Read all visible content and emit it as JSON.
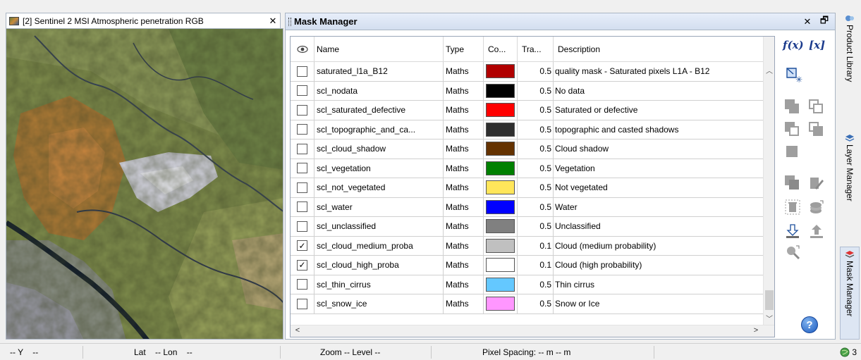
{
  "image_view": {
    "tab_title": "[2] Sentinel 2 MSI Atmospheric penetration RGB",
    "close_glyph": "✕"
  },
  "mask_manager": {
    "title": "Mask Manager",
    "close_glyph": "✕",
    "restore_glyph": "🗗",
    "columns": [
      "Name",
      "Type",
      "Co...",
      "Tra...",
      "Description"
    ],
    "rows": [
      {
        "checked": false,
        "name": "saturated_l1a_B12",
        "type": "Maths",
        "color": "#b10000",
        "transparency": "0.5",
        "description": "quality mask - Saturated pixels L1A - B12"
      },
      {
        "checked": false,
        "name": "scl_nodata",
        "type": "Maths",
        "color": "#000000",
        "transparency": "0.5",
        "description": "No data"
      },
      {
        "checked": false,
        "name": "scl_saturated_defective",
        "type": "Maths",
        "color": "#ff0000",
        "transparency": "0.5",
        "description": "Saturated or defective"
      },
      {
        "checked": false,
        "name": "scl_topographic_and_ca...",
        "type": "Maths",
        "color": "#2e2e2e",
        "transparency": "0.5",
        "description": "topographic and casted shadows"
      },
      {
        "checked": false,
        "name": "scl_cloud_shadow",
        "type": "Maths",
        "color": "#643200",
        "transparency": "0.5",
        "description": "Cloud shadow"
      },
      {
        "checked": false,
        "name": "scl_vegetation",
        "type": "Maths",
        "color": "#008000",
        "transparency": "0.5",
        "description": "Vegetation"
      },
      {
        "checked": false,
        "name": "scl_not_vegetated",
        "type": "Maths",
        "color": "#ffe65a",
        "transparency": "0.5",
        "description": "Not vegetated"
      },
      {
        "checked": false,
        "name": "scl_water",
        "type": "Maths",
        "color": "#0000ff",
        "transparency": "0.5",
        "description": "Water"
      },
      {
        "checked": false,
        "name": "scl_unclassified",
        "type": "Maths",
        "color": "#808080",
        "transparency": "0.5",
        "description": "Unclassified"
      },
      {
        "checked": true,
        "name": "scl_cloud_medium_proba",
        "type": "Maths",
        "color": "#c0c0c0",
        "transparency": "0.1",
        "description": "Cloud (medium probability)"
      },
      {
        "checked": true,
        "name": "scl_cloud_high_proba",
        "type": "Maths",
        "color": "#ffffff",
        "transparency": "0.1",
        "description": "Cloud (high probability)"
      },
      {
        "checked": false,
        "name": "scl_thin_cirrus",
        "type": "Maths",
        "color": "#64c8ff",
        "transparency": "0.5",
        "description": "Thin cirrus"
      },
      {
        "checked": false,
        "name": "scl_snow_ice",
        "type": "Maths",
        "color": "#ff96ff",
        "transparency": "0.5",
        "description": "Snow or Ice"
      }
    ],
    "tools": {
      "fx_label": "f(x)",
      "var_label": "[x]",
      "help_label": "?"
    }
  },
  "side_tabs": [
    "Product Library",
    "Layer Manager",
    "Mask Manager"
  ],
  "status_bar": {
    "y": "-- Y    --",
    "latlon": "Lat    -- Lon    --",
    "zoom": "Zoom -- Level --",
    "pixel_spacing": "Pixel Spacing: -- m -- m",
    "count": "3"
  }
}
